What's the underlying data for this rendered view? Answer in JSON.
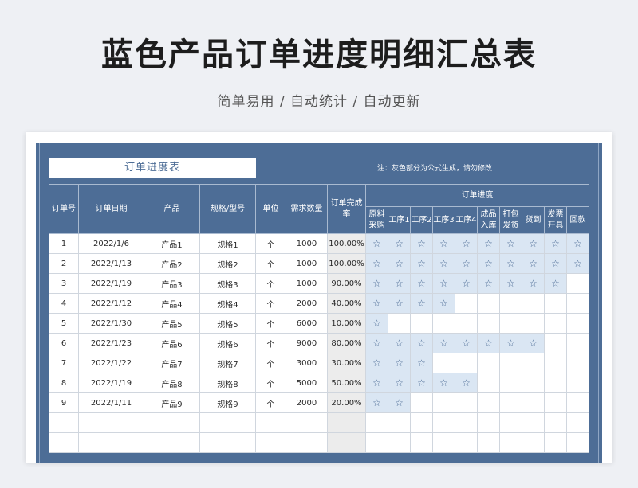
{
  "page": {
    "title": "蓝色产品订单进度明细汇总表",
    "subtitle": "简单易用  /  自动统计  /  自动更新"
  },
  "sheet": {
    "table_title": "订单进度表",
    "note": "注：灰色部分为公式生成，请勿修改",
    "headers": {
      "no": "订单号",
      "date": "订单日期",
      "product": "产品",
      "spec": "规格/型号",
      "unit": "单位",
      "qty": "需求数量",
      "rate": "订单完成率",
      "progress": "订单进度"
    },
    "stages": [
      "原料采购",
      "工序1",
      "工序2",
      "工序3",
      "工序4",
      "成品入库",
      "打包发货",
      "货到",
      "发票开具",
      "回款"
    ],
    "star_symbol": "☆",
    "rows": [
      {
        "no": "1",
        "date": "2022/1/6",
        "product": "产品1",
        "spec": "规格1",
        "unit": "个",
        "qty": "1000",
        "rate": "100.00%",
        "stars": 10
      },
      {
        "no": "2",
        "date": "2022/1/13",
        "product": "产品2",
        "spec": "规格2",
        "unit": "个",
        "qty": "1000",
        "rate": "100.00%",
        "stars": 10
      },
      {
        "no": "3",
        "date": "2022/1/19",
        "product": "产品3",
        "spec": "规格3",
        "unit": "个",
        "qty": "1000",
        "rate": "90.00%",
        "stars": 9
      },
      {
        "no": "4",
        "date": "2022/1/12",
        "product": "产品4",
        "spec": "规格4",
        "unit": "个",
        "qty": "2000",
        "rate": "40.00%",
        "stars": 4
      },
      {
        "no": "5",
        "date": "2022/1/30",
        "product": "产品5",
        "spec": "规格5",
        "unit": "个",
        "qty": "6000",
        "rate": "10.00%",
        "stars": 1
      },
      {
        "no": "6",
        "date": "2022/1/23",
        "product": "产品6",
        "spec": "规格6",
        "unit": "个",
        "qty": "9000",
        "rate": "80.00%",
        "stars": 8
      },
      {
        "no": "7",
        "date": "2022/1/22",
        "product": "产品7",
        "spec": "规格7",
        "unit": "个",
        "qty": "3000",
        "rate": "30.00%",
        "stars": 3
      },
      {
        "no": "8",
        "date": "2022/1/19",
        "product": "产品8",
        "spec": "规格8",
        "unit": "个",
        "qty": "5000",
        "rate": "50.00%",
        "stars": 5
      },
      {
        "no": "9",
        "date": "2022/1/11",
        "product": "产品9",
        "spec": "规格9",
        "unit": "个",
        "qty": "2000",
        "rate": "20.00%",
        "stars": 2
      }
    ],
    "empty_rows": 2
  },
  "colors": {
    "header_blue": "#4d6d96",
    "star_fill": "#dae6f3",
    "formula_gray": "#ececec"
  }
}
